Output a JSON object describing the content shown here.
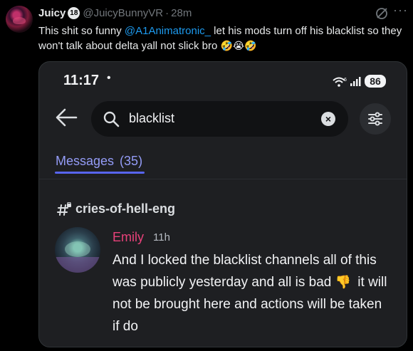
{
  "tweet": {
    "display_name": "Juicy",
    "age_badge": "18",
    "handle": "@JuicyBunnyVR",
    "separator": "·",
    "time": "28m",
    "text_before": "This shit so funny ",
    "mention": "@A1Animatronic_",
    "text_after": " let his mods turn off his blacklist so they won't talk about delta yall not slick bro ",
    "emojis": "🤣😭🤣"
  },
  "phone": {
    "clock": "11:17",
    "clock_dot": "•",
    "wifi_badge": "6",
    "battery": "86",
    "search": {
      "value": "blacklist",
      "clear": "×"
    },
    "tab": {
      "label": "Messages",
      "count": "(35)"
    },
    "channel": "cries-of-hell-eng",
    "message": {
      "author": "Emily",
      "time": "11h",
      "text_before": "And I locked the blacklist channels all of this was publicly yesterday and all is bad ",
      "emoji": "👎",
      "text_after": " it will not be brought here and actions will be taken if do"
    },
    "colors": {
      "background": "#1e1f22",
      "accent": "#949cf7",
      "author": "#e8417a"
    }
  }
}
